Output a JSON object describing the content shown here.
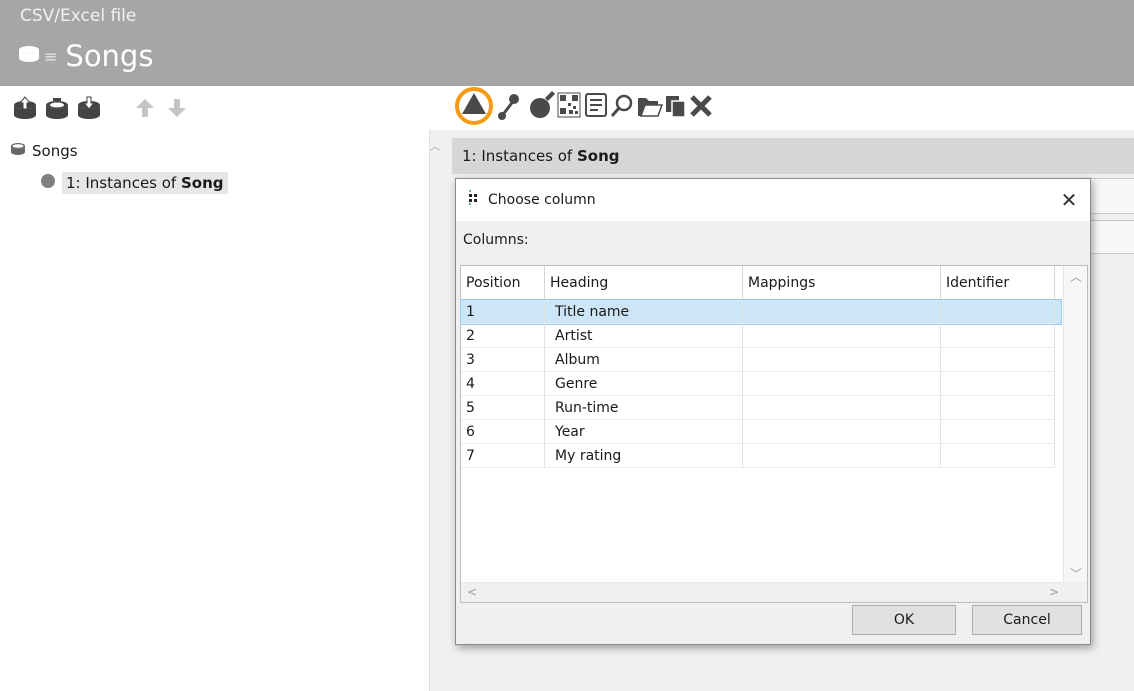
{
  "header": {
    "subtitle": "CSV/Excel file",
    "title": "Songs"
  },
  "toolbar_left": [
    {
      "icon": "database-upload-icon"
    },
    {
      "icon": "database-add-icon"
    },
    {
      "icon": "database-download-icon"
    },
    {
      "icon": "move-up-icon"
    },
    {
      "icon": "move-down-icon"
    }
  ],
  "toolbar_right": [
    {
      "icon": "triangle-icon",
      "highlighted": true
    },
    {
      "icon": "link-icon"
    },
    {
      "icon": "sphere-edit-icon"
    },
    {
      "icon": "qr-code-icon"
    },
    {
      "icon": "document-icon"
    },
    {
      "icon": "search-icon"
    },
    {
      "icon": "open-folder-icon"
    },
    {
      "icon": "copy-icon"
    },
    {
      "icon": "delete-icon"
    }
  ],
  "highlight_color": "#f39c12",
  "tree": {
    "root_label": "Songs",
    "child_prefix": "1: Instances of ",
    "child_bold": "Song"
  },
  "instance_bar": {
    "prefix": "1: Instances of ",
    "bold": "Song"
  },
  "dialog": {
    "title": "Choose column",
    "columns_label": "Columns:",
    "headers": [
      "Position",
      "Heading",
      "Mappings",
      "Identifier"
    ],
    "rows": [
      {
        "position": "1",
        "heading": "Title name",
        "mappings": "",
        "identifier": ""
      },
      {
        "position": "2",
        "heading": "Artist",
        "mappings": "",
        "identifier": ""
      },
      {
        "position": "3",
        "heading": "Album",
        "mappings": "",
        "identifier": ""
      },
      {
        "position": "4",
        "heading": "Genre",
        "mappings": "",
        "identifier": ""
      },
      {
        "position": "5",
        "heading": "Run-time",
        "mappings": "",
        "identifier": ""
      },
      {
        "position": "6",
        "heading": "Year",
        "mappings": "",
        "identifier": ""
      },
      {
        "position": "7",
        "heading": "My rating",
        "mappings": "",
        "identifier": ""
      }
    ],
    "selected_row": 0,
    "ok_label": "OK",
    "cancel_label": "Cancel",
    "selection_color": "#cde6f7"
  }
}
